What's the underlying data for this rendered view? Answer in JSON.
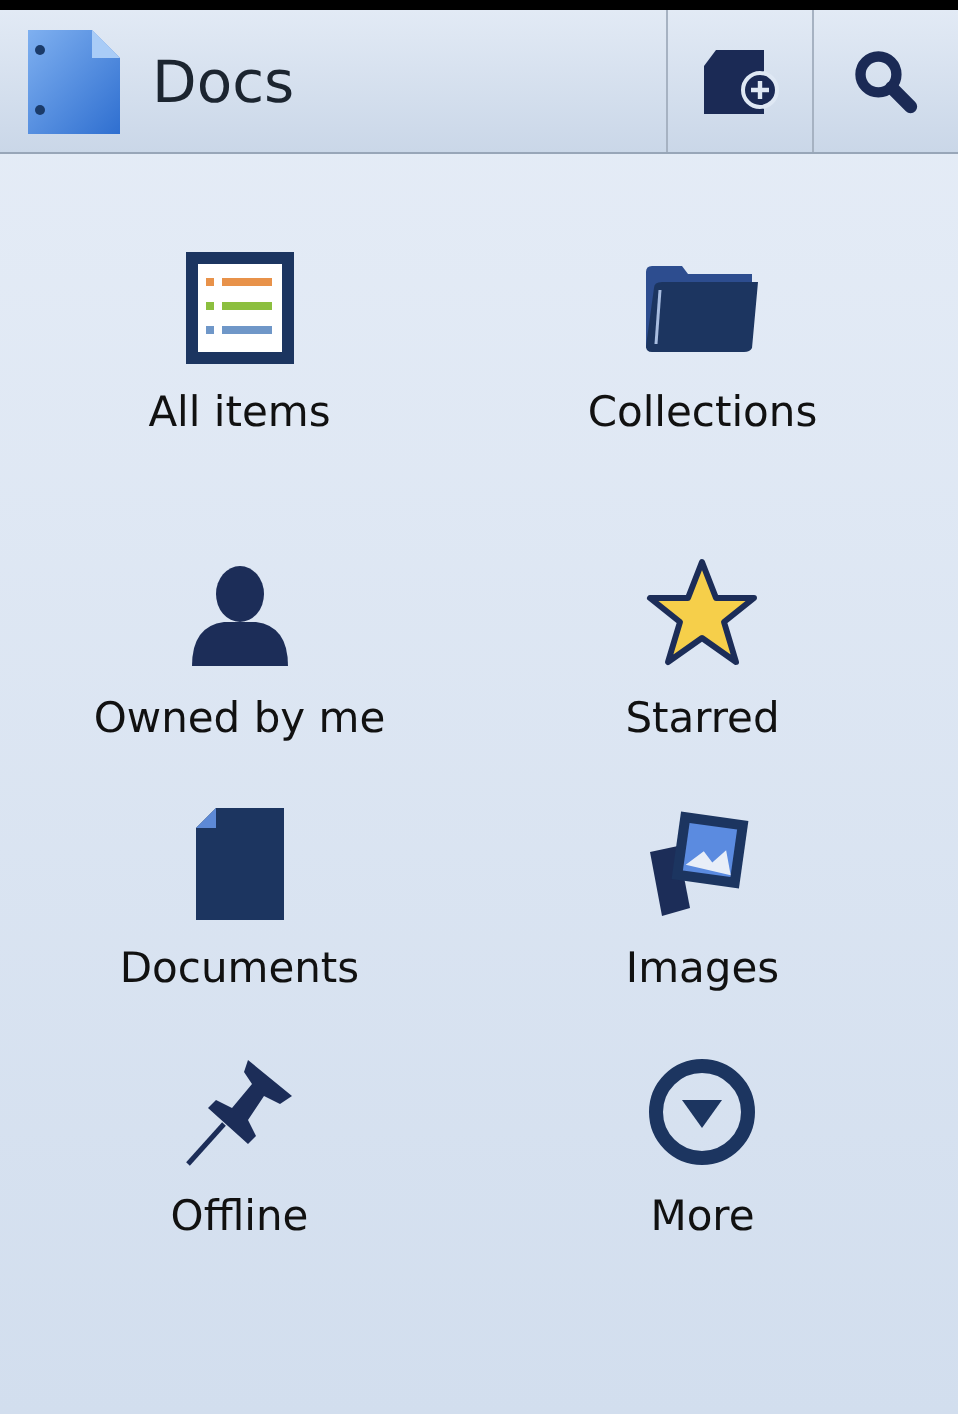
{
  "app_bar": {
    "title": "Docs"
  },
  "items": [
    {
      "label": "All items",
      "kind": "list"
    },
    {
      "label": "Collections",
      "kind": "folder"
    },
    {
      "label": "Owned by me",
      "kind": "person"
    },
    {
      "label": "Starred",
      "kind": "star"
    },
    {
      "label": "Documents",
      "kind": "document"
    },
    {
      "label": "Images",
      "kind": "images"
    },
    {
      "label": "Offline",
      "kind": "pin"
    },
    {
      "label": "More",
      "kind": "more"
    }
  ]
}
